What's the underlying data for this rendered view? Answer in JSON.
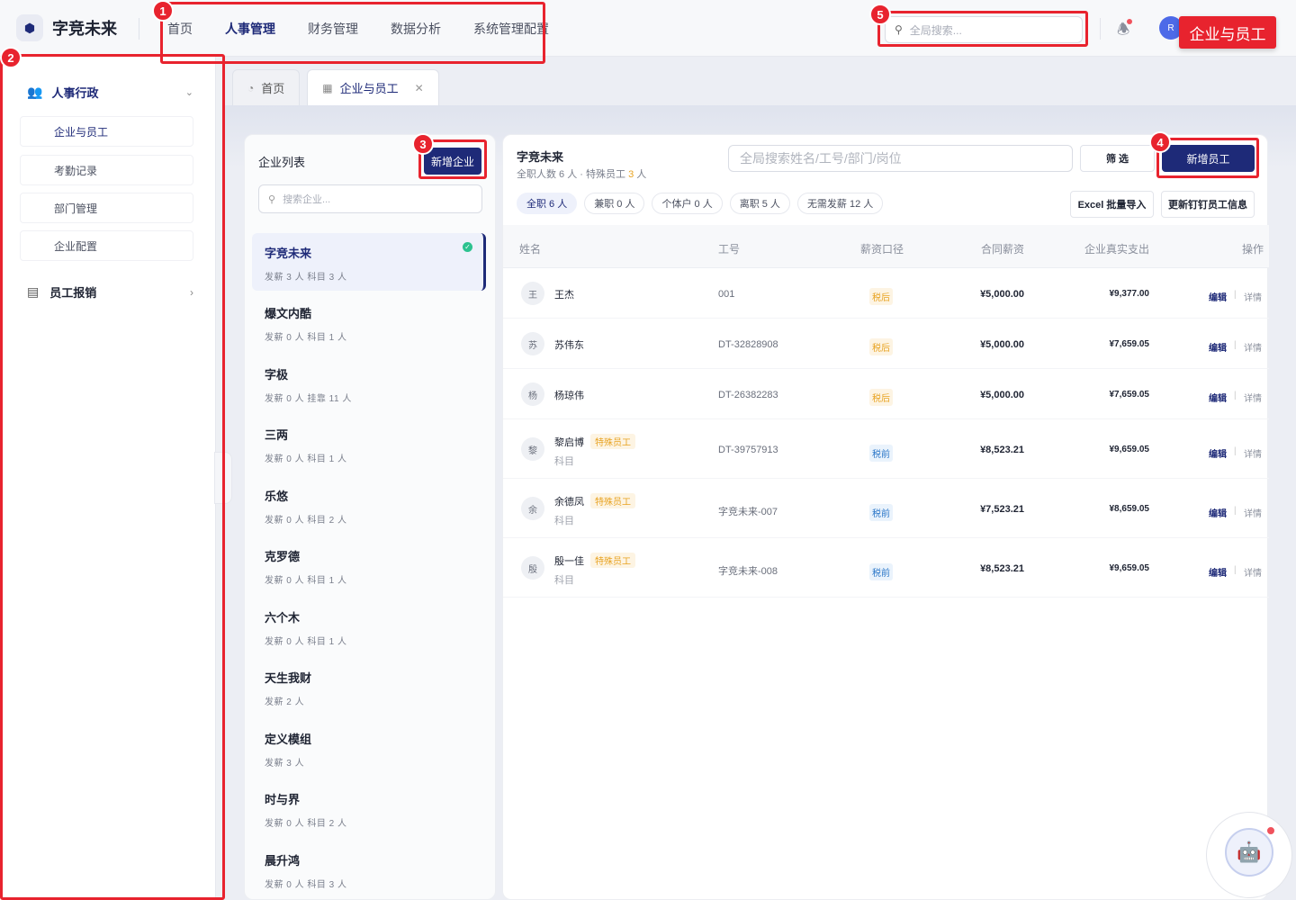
{
  "app": {
    "name": "字竞未来",
    "logo_icon": "hexagon-icon"
  },
  "topnav": [
    {
      "label": "首页",
      "active": false
    },
    {
      "label": "人事管理",
      "active": true
    },
    {
      "label": "财务管理",
      "active": false
    },
    {
      "label": "数据分析",
      "active": false
    },
    {
      "label": "系统管理配置",
      "active": false
    }
  ],
  "header": {
    "search_placeholder": "全局搜索...",
    "avatar_initial": "R",
    "page_label": "企业与员工"
  },
  "sidebar": {
    "group1": {
      "label": "人事行政",
      "items": [
        "企业与员工",
        "考勤记录",
        "部门管理",
        "企业配置"
      ]
    },
    "group2": {
      "label": "员工报销"
    }
  },
  "tabs": [
    {
      "label": "首页",
      "active": false
    },
    {
      "label": "企业与员工",
      "active": true
    }
  ],
  "company_list": {
    "title": "企业列表",
    "add_button": "新增企业",
    "search_placeholder": "搜索企业...",
    "items": [
      {
        "name": "字竞未来",
        "stat": "发薪 3 人 科目 3 人",
        "selected": true
      },
      {
        "name": "爆文内酷",
        "stat": "发薪 0 人 科目 1 人"
      },
      {
        "name": "字极",
        "stat": "发薪 0 人 挂靠 11 人"
      },
      {
        "name": "三两",
        "stat": "发薪 0 人 科目 1 人"
      },
      {
        "name": "乐悠",
        "stat": "发薪 0 人 科目 2 人"
      },
      {
        "name": "克罗德",
        "stat": "发薪 0 人 科目 1 人"
      },
      {
        "name": "六个木",
        "stat": "发薪 0 人 科目 1 人"
      },
      {
        "name": "天生我财",
        "stat": "发薪 2 人"
      },
      {
        "name": "定义模组",
        "stat": "发薪 3 人"
      },
      {
        "name": "时与界",
        "stat": "发薪 0 人 科目 2 人"
      },
      {
        "name": "晨升鸿",
        "stat": "发薪 0 人 科目 3 人"
      }
    ]
  },
  "employees": {
    "company": "字竞未来",
    "sub_a": "全职人数 6 人 · 特殊员工 ",
    "sub_count": "3",
    "sub_b": " 人",
    "search_placeholder": "全局搜索姓名/工号/部门/岗位",
    "filter_button": "筛 选",
    "add_button": "新增员工",
    "chips": [
      "全职 6 人",
      "兼职 0 人",
      "个体户 0 人",
      "离职 5 人",
      "无需发薪 12 人"
    ],
    "import_button": "Excel 批量导入",
    "sync_button": "更新钉钉员工信息",
    "columns": [
      "姓名",
      "工号",
      "薪资口径",
      "合同薪资",
      "企业真实支出",
      "操作"
    ],
    "rows": [
      {
        "avatar": "王",
        "name": "王杰",
        "badge": "",
        "sub": "",
        "id": "001",
        "tax": "税后",
        "salary": "¥5,000.00",
        "expense": "¥9,377.00"
      },
      {
        "avatar": "苏",
        "name": "苏伟东",
        "badge": "",
        "sub": "",
        "id": "DT-32828908",
        "tax": "税后",
        "salary": "¥5,000.00",
        "expense": "¥7,659.05"
      },
      {
        "avatar": "杨",
        "name": "杨琼伟",
        "badge": "",
        "sub": "",
        "id": "DT-26382283",
        "tax": "税后",
        "salary": "¥5,000.00",
        "expense": "¥7,659.05"
      },
      {
        "avatar": "黎",
        "name": "黎启博",
        "badge": "特殊员工",
        "sub": "科目",
        "id": "DT-39757913",
        "tax": "税前",
        "salary": "¥8,523.21",
        "expense": "¥9,659.05"
      },
      {
        "avatar": "余",
        "name": "余德凤",
        "badge": "特殊员工",
        "sub": "科目",
        "id": "字竞未来-007",
        "tax": "税前",
        "salary": "¥7,523.21",
        "expense": "¥8,659.05"
      },
      {
        "avatar": "殷",
        "name": "殷一佳",
        "badge": "特殊员工",
        "sub": "科目",
        "id": "字竞未来-008",
        "tax": "税前",
        "salary": "¥8,523.21",
        "expense": "¥9,659.05"
      }
    ],
    "edit_label": "编辑",
    "detail_label": "详情",
    "sep": "|"
  },
  "annotations": [
    "1",
    "2",
    "3",
    "4",
    "5"
  ],
  "colors": {
    "brand": "#1e2a78",
    "annotation": "#e8232e",
    "warning": "#e8a322"
  }
}
